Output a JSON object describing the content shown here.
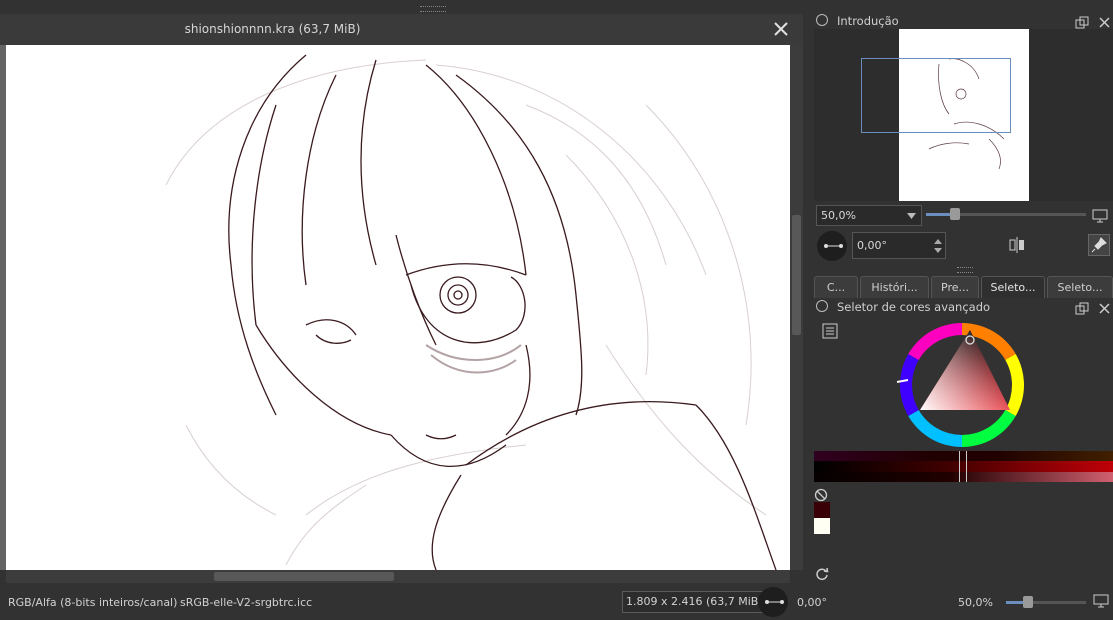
{
  "document": {
    "title": "shionshionnnn.kra (63,7 MiB)"
  },
  "overview_docker": {
    "title": "Introdução",
    "zoom_value": "50,0%",
    "zoom_slider": 0.18,
    "rotation_value": "0,00°"
  },
  "tabs": [
    {
      "label": "C..."
    },
    {
      "label": "Históri..."
    },
    {
      "label": "Pre..."
    },
    {
      "label": "Seleto..."
    },
    {
      "label": "Seleto..."
    }
  ],
  "color_docker": {
    "title": "Seletor de cores avançado"
  },
  "colors": {
    "foreground": "#3a0008",
    "background": "#fffff4",
    "accent_selection": "#6a8fbf"
  },
  "statusbar": {
    "color_space": "RGB/Alfa (8-bits inteiros/canal)",
    "profile": "sRGB-elle-V2-srgbtrc.icc",
    "dimensions": "1.809 x 2.416 (63,7 MiB)",
    "rotation": "0,00°",
    "zoom": "50,0%",
    "zoom_slider": 0.28
  }
}
